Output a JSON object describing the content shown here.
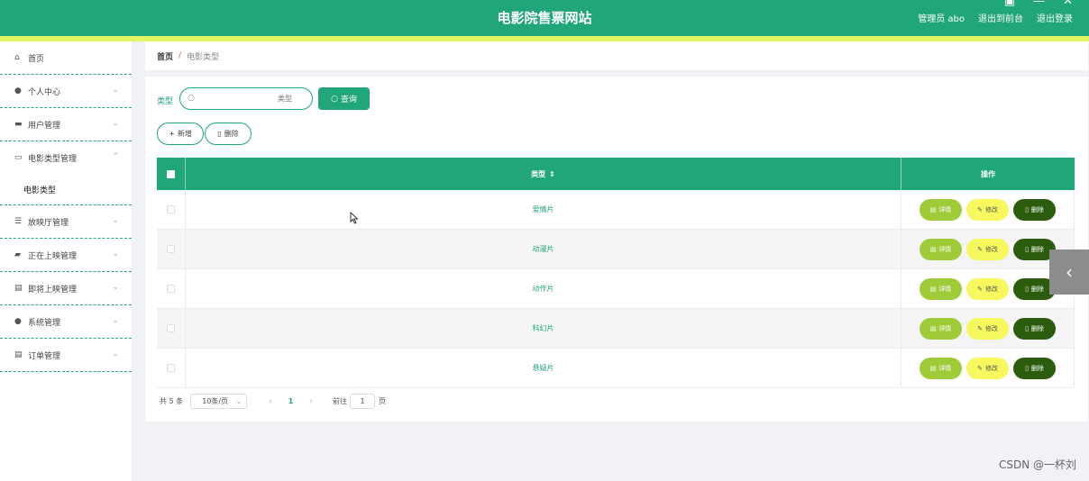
{
  "header": {
    "title": "电影院售票网站",
    "user_label": "管理员 abo",
    "back_label": "退出到前台",
    "logout_label": "退出登录",
    "bg_color": "#21a677",
    "stripe_color": "#e3f567"
  },
  "sidebar": {
    "items": [
      {
        "label": "首页",
        "icon": "home-icon"
      },
      {
        "label": "个人中心",
        "icon": "user-icon"
      },
      {
        "label": "用户管理",
        "icon": "chat-icon"
      },
      {
        "label": "电影类型管理",
        "icon": "monitor-icon"
      },
      {
        "label": "电影类型",
        "icon": ""
      },
      {
        "label": "放映厅管理",
        "icon": "sliders-icon"
      },
      {
        "label": "正在上映管理",
        "icon": "printer-icon"
      },
      {
        "label": "即将上映管理",
        "icon": "clipboard-icon"
      },
      {
        "label": "系统管理",
        "icon": "pin-icon"
      },
      {
        "label": "订单管理",
        "icon": "document-icon"
      }
    ]
  },
  "breadcrumb": {
    "home": "首页",
    "separator": "/",
    "current": "电影类型"
  },
  "search": {
    "label": "类型",
    "placeholder": "类型",
    "button": "查询"
  },
  "actions": {
    "add": "新增",
    "delete": "删除"
  },
  "table": {
    "headers": {
      "type": "类型",
      "ops": "操作"
    },
    "rows": [
      {
        "type": "爱情片"
      },
      {
        "type": "动漫片"
      },
      {
        "type": "动作片"
      },
      {
        "type": "科幻片"
      },
      {
        "type": "悬疑片"
      }
    ],
    "op_labels": {
      "detail": "详情",
      "edit": "修改",
      "delete": "删除"
    }
  },
  "pagination": {
    "total": "共 5 条",
    "page_size": "10条/页",
    "current_page": "1",
    "goto_label": "前往",
    "goto_value": "1",
    "page_suffix": "页"
  },
  "watermark": "CSDN @一杯刘"
}
